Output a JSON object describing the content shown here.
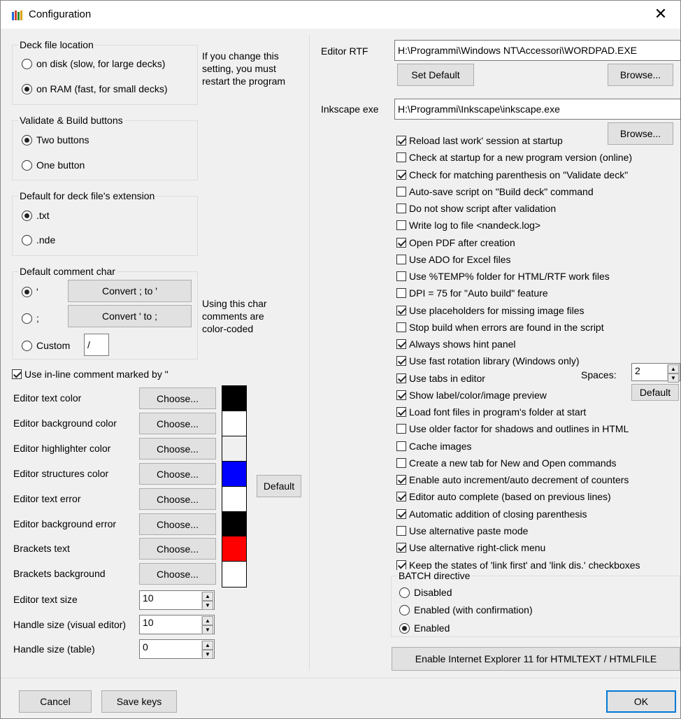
{
  "window": {
    "title": "Configuration",
    "close": "✕"
  },
  "deck_location": {
    "caption": "Deck file location",
    "options": [
      "on disk (slow, for large decks)",
      "on RAM (fast, for small decks)"
    ],
    "selected": 1,
    "note": [
      "If you change this",
      "setting, you must",
      "restart the program"
    ]
  },
  "validate_build": {
    "caption": "Validate & Build buttons",
    "options": [
      "Two buttons",
      "One button"
    ],
    "selected": 0
  },
  "extension": {
    "caption": "Default for deck file's extension",
    "options": [
      ".txt",
      ".nde"
    ],
    "selected": 0
  },
  "comment_char": {
    "caption": "Default comment char",
    "options": [
      "'",
      ";",
      "Custom"
    ],
    "selected": 0,
    "convert1": "Convert ; to '",
    "convert2": "Convert ' to ;",
    "custom_value": "/",
    "note": [
      "Using this char",
      "comments are",
      "color-coded"
    ]
  },
  "inline_comment": {
    "label": "Use in-line comment marked by \"",
    "checked": true
  },
  "colors": {
    "choose_label": "Choose...",
    "default_label": "Default",
    "items": [
      {
        "label": "Editor text color",
        "color": "#000000"
      },
      {
        "label": "Editor background color",
        "color": "#ffffff"
      },
      {
        "label": "Editor highlighter color",
        "color": "#f0f0f0"
      },
      {
        "label": "Editor structures color",
        "color": "#0000ff"
      },
      {
        "label": "Editor text error",
        "color": "#ffffff"
      },
      {
        "label": "Editor background error",
        "color": "#000000"
      },
      {
        "label": "Brackets text",
        "color": "#ff0000"
      },
      {
        "label": "Brackets background",
        "color": "#ffffff"
      }
    ]
  },
  "sizes": [
    {
      "label": "Editor text size",
      "value": "10"
    },
    {
      "label": "Handle size (visual editor)",
      "value": "10"
    },
    {
      "label": "Handle size (table)",
      "value": "0"
    }
  ],
  "editor_rtf": {
    "label": "Editor RTF",
    "value": "H:\\Programmi\\Windows NT\\Accessori\\WORDPAD.EXE",
    "set_default": "Set Default",
    "browse": "Browse..."
  },
  "inkscape": {
    "label": "Inkscape exe",
    "value": "H:\\Programmi\\Inkscape\\inkscape.exe",
    "browse": "Browse..."
  },
  "options": [
    {
      "label": "Reload last work' session at startup",
      "checked": true
    },
    {
      "label": "Check at startup for a new program version (online)",
      "checked": false
    },
    {
      "label": "Check for matching parenthesis on \"Validate deck\"",
      "checked": true
    },
    {
      "label": "Auto-save script on \"Build deck\" command",
      "checked": false
    },
    {
      "label": "Do not show script after validation",
      "checked": false
    },
    {
      "label": "Write log to file <nandeck.log>",
      "checked": false
    },
    {
      "label": "Open PDF after creation",
      "checked": true
    },
    {
      "label": "Use ADO for Excel files",
      "checked": false
    },
    {
      "label": "Use %TEMP% folder for HTML/RTF work files",
      "checked": false
    },
    {
      "label": "DPI = 75 for \"Auto build\" feature",
      "checked": false
    },
    {
      "label": "Use placeholders for missing image files",
      "checked": true
    },
    {
      "label": "Stop build when errors are found in the script",
      "checked": false
    },
    {
      "label": "Always shows hint panel",
      "checked": true
    },
    {
      "label": "Use fast rotation library (Windows only)",
      "checked": true
    },
    {
      "label": "Use tabs in editor",
      "checked": true
    },
    {
      "label": "Show label/color/image preview",
      "checked": true
    },
    {
      "label": "Load font files in program's folder at start",
      "checked": true
    },
    {
      "label": "Use older factor for shadows and outlines in HTML",
      "checked": false
    },
    {
      "label": "Cache images",
      "checked": false
    },
    {
      "label": "Create a new tab for New and Open commands",
      "checked": false
    },
    {
      "label": "Enable auto increment/auto decrement of counters",
      "checked": true
    },
    {
      "label": "Editor auto complete (based on previous lines)",
      "checked": true
    },
    {
      "label": "Automatic addition of closing parenthesis",
      "checked": true
    },
    {
      "label": "Use alternative paste mode",
      "checked": false
    },
    {
      "label": "Use alternative right-click menu",
      "checked": true
    },
    {
      "label": "Keep the states of 'link first' and 'link dis.' checkboxes",
      "checked": true
    }
  ],
  "spaces": {
    "label": "Spaces:",
    "value": "2",
    "default": "Default"
  },
  "batch": {
    "caption": "BATCH directive",
    "options": [
      "Disabled",
      "Enabled (with confirmation)",
      "Enabled"
    ],
    "selected": 2
  },
  "ie11_button": "Enable Internet Explorer 11 for HTMLTEXT / HTMLFILE",
  "footer": {
    "cancel": "Cancel",
    "save_keys": "Save keys",
    "ok": "OK"
  }
}
